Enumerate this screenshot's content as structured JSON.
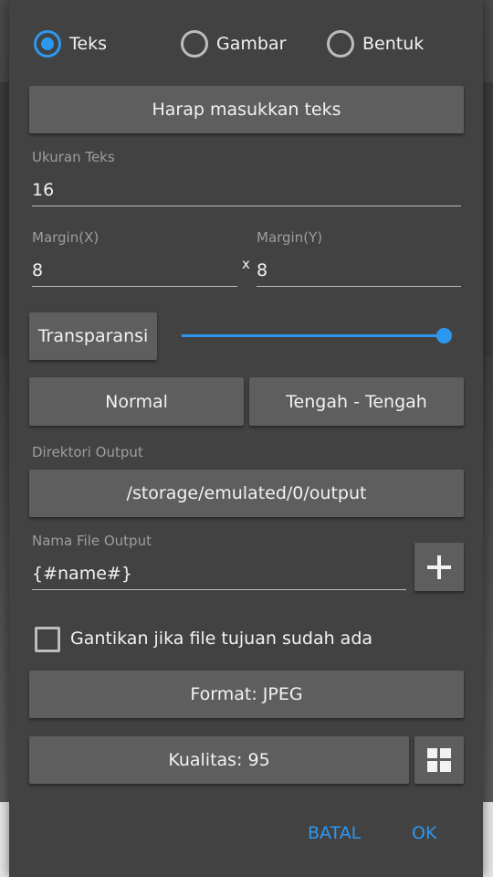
{
  "mode_options": [
    {
      "label": "Teks",
      "checked": true
    },
    {
      "label": "Gambar",
      "checked": false
    },
    {
      "label": "Bentuk",
      "checked": false
    }
  ],
  "text_button": "Harap masukkan teks",
  "text_size": {
    "label": "Ukuran Teks",
    "value": "16"
  },
  "margin_x": {
    "label": "Margin(X)",
    "value": "8"
  },
  "margin_separator": "x",
  "margin_y": {
    "label": "Margin(Y)",
    "value": "8"
  },
  "transparency": {
    "label": "Transparansi",
    "value": 1.0
  },
  "blend_button": "Normal",
  "position_button": "Tengah - Tengah",
  "output_dir": {
    "label": "Direktori Output",
    "value": "/storage/emulated/0/output"
  },
  "output_name": {
    "label": "Nama File Output",
    "value": "{#name#}",
    "add_icon": "plus-icon"
  },
  "overwrite": {
    "label": "Gantikan jika file tujuan sudah ada",
    "checked": false
  },
  "format_button": "Format: JPEG",
  "quality_button": "Kualitas: 95",
  "quality_icon": "grid-icon",
  "actions": {
    "cancel": "BATAL",
    "ok": "OK"
  },
  "colors": {
    "accent": "#2d97f0",
    "dialog": "#424242",
    "button": "#5e5e5e"
  }
}
